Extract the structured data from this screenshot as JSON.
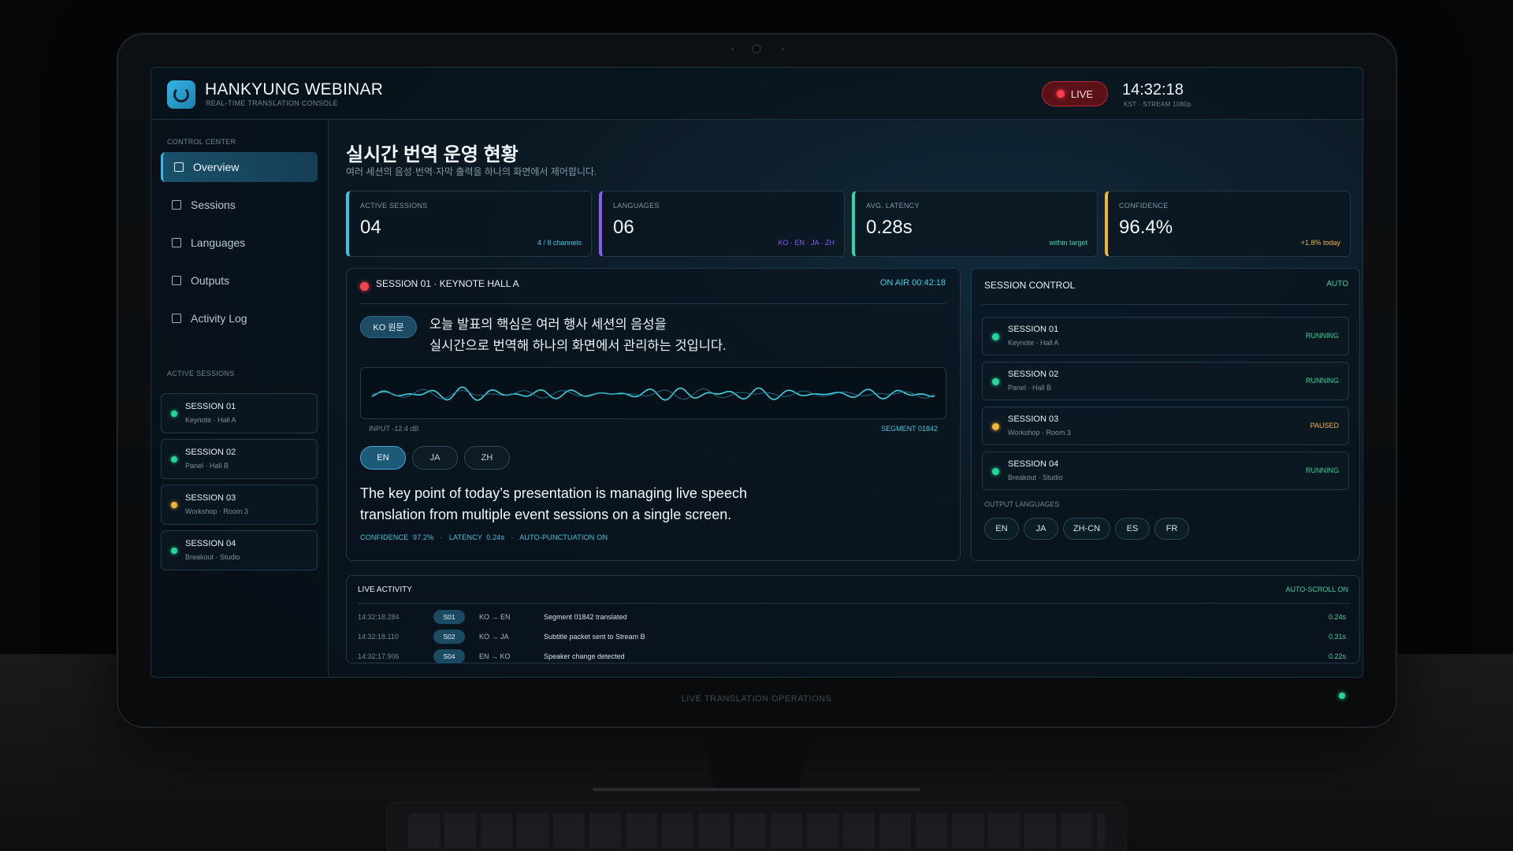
{
  "app": {
    "title": "HANKYUNG WEBINAR",
    "subtitle": "REAL-TIME TRANSLATION CONSOLE",
    "live_label": "LIVE",
    "clock": "14:32:18",
    "clock_sub": "KST · STREAM 1080p",
    "bezel_label": "LIVE TRANSLATION OPERATIONS"
  },
  "sidebar": {
    "control_head": "CONTROL CENTER",
    "nav": [
      {
        "label": "Overview",
        "active": true
      },
      {
        "label": "Sessions"
      },
      {
        "label": "Languages"
      },
      {
        "label": "Outputs"
      },
      {
        "label": "Activity Log"
      }
    ],
    "sessions_head": "ACTIVE SESSIONS",
    "sessions": [
      {
        "title": "SESSION 01",
        "sub": "Keynote · Hall A",
        "status_color": "#25d69a"
      },
      {
        "title": "SESSION 02",
        "sub": "Panel · Hall B",
        "status_color": "#25d69a"
      },
      {
        "title": "SESSION 03",
        "sub": "Workshop · Room 3",
        "status_color": "#f0b63a"
      },
      {
        "title": "SESSION 04",
        "sub": "Breakout · Studio",
        "status_color": "#25d69a"
      }
    ]
  },
  "main": {
    "title": "실시간 번역 운영 현황",
    "subtitle": "여러 세션의 음성·번역·자막 출력을 하나의 화면에서 제어합니다."
  },
  "kpis": [
    {
      "label": "ACTIVE SESSIONS",
      "value": "04",
      "note": "4 / 8 channels",
      "color": "#3ec3e8"
    },
    {
      "label": "LANGUAGES",
      "value": "06",
      "note": "KO · EN · JA · ZH",
      "color": "#8a5cf0"
    },
    {
      "label": "AVG. LATENCY",
      "value": "0.28s",
      "note": "within target",
      "color": "#2fd6b0"
    },
    {
      "label": "CONFIDENCE",
      "value": "96.4%",
      "note": "+1.8% today",
      "color": "#f0b63a"
    }
  ],
  "live_session": {
    "title": "SESSION 01 · KEYNOTE HALL A",
    "on_air": "ON AIR  00:42:18",
    "source_badge": "KO 원문",
    "source_line1": "오늘 발표의 핵심은 여러 행사 세션의 음성을",
    "source_line2": "실시간으로 번역해 하나의 화면에서 관리하는 것입니다.",
    "input_level": "INPUT -12.4 dB",
    "segment": "SEGMENT 01842",
    "tabs": [
      "EN",
      "JA",
      "ZH"
    ],
    "active_tab": "EN",
    "translation_line1": "The key point of today’s presentation is managing live speech",
    "translation_line2": "translation from multiple event sessions on a single screen.",
    "meta": "CONFIDENCE  97.2%   ·   LATENCY  0.24s   ·   AUTO-PUNCTUATION ON"
  },
  "session_control": {
    "title": "SESSION CONTROL",
    "mode": "AUTO",
    "rows": [
      {
        "title": "SESSION 01",
        "sub": "Keynote · Hall A",
        "status": "RUNNING",
        "color": "#25d69a"
      },
      {
        "title": "SESSION 02",
        "sub": "Panel · Hall B",
        "status": "RUNNING",
        "color": "#25d69a"
      },
      {
        "title": "SESSION 03",
        "sub": "Workshop · Room 3",
        "status": "PAUSED",
        "color": "#f0b63a"
      },
      {
        "title": "SESSION 04",
        "sub": "Breakout · Studio",
        "status": "RUNNING",
        "color": "#25d69a"
      }
    ],
    "output_head": "OUTPUT LANGUAGES",
    "outputs": [
      "EN",
      "JA",
      "ZH-CN",
      "ES",
      "FR"
    ]
  },
  "activity": {
    "title": "LIVE ACTIVITY",
    "mode": "AUTO-SCROLL ON",
    "rows": [
      {
        "ts": "14:32:18.284",
        "tag": "S01",
        "dir": "KO → EN",
        "msg": "Segment 01842 translated",
        "lat": "0.24s"
      },
      {
        "ts": "14:32:18.110",
        "tag": "S02",
        "dir": "KO → JA",
        "msg": "Subtitle packet sent to Stream B",
        "lat": "0.31s"
      },
      {
        "ts": "14:32:17.906",
        "tag": "S04",
        "dir": "EN → KO",
        "msg": "Speaker change detected",
        "lat": "0.22s"
      }
    ]
  }
}
